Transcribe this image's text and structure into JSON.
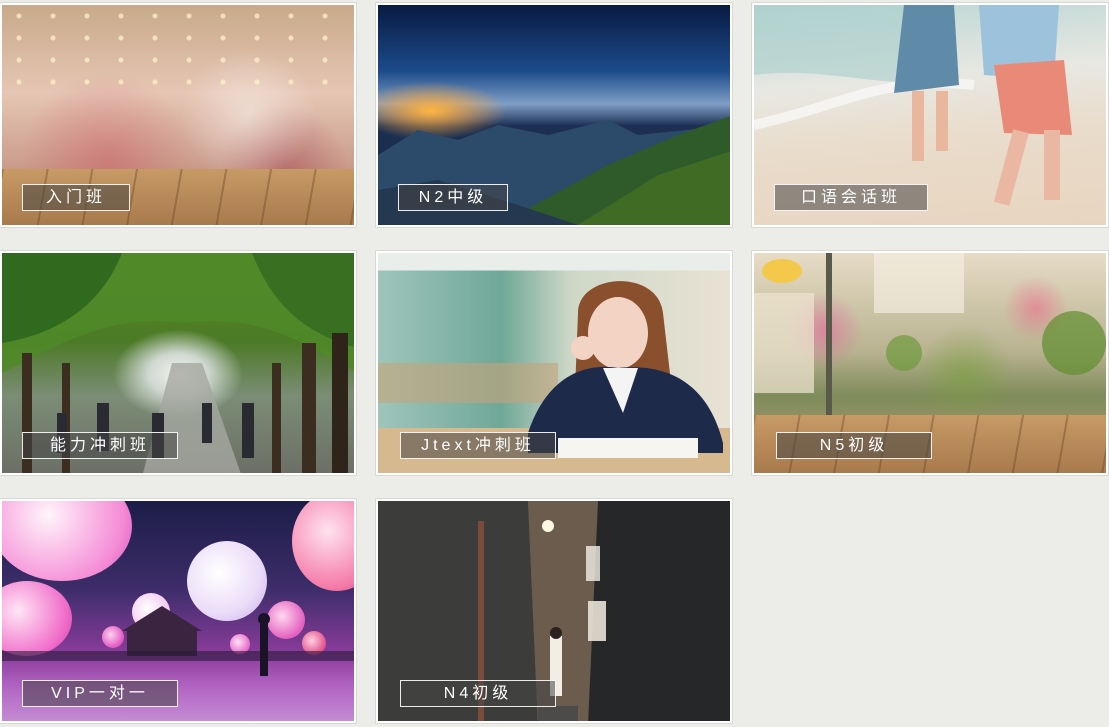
{
  "courses": [
    {
      "label": "入门班"
    },
    {
      "label": "N2中级"
    },
    {
      "label": "口语会话班"
    },
    {
      "label": "能力冲刺班"
    },
    {
      "label": "Jtext冲刺班"
    },
    {
      "label": "N5初级"
    },
    {
      "label": "VIP一对一"
    },
    {
      "label": "N4初级"
    }
  ],
  "colors": {
    "page_background": "#ecece9",
    "label_background": "rgba(70,70,70,0.55)",
    "label_border": "#ffffff",
    "label_text": "#ffffff"
  },
  "icons": [
    "mall-photo",
    "mountain-photo",
    "beach-photo",
    "avenue-photo",
    "classroom-photo",
    "flower-street-photo",
    "balloon-photo",
    "alley-photo"
  ]
}
